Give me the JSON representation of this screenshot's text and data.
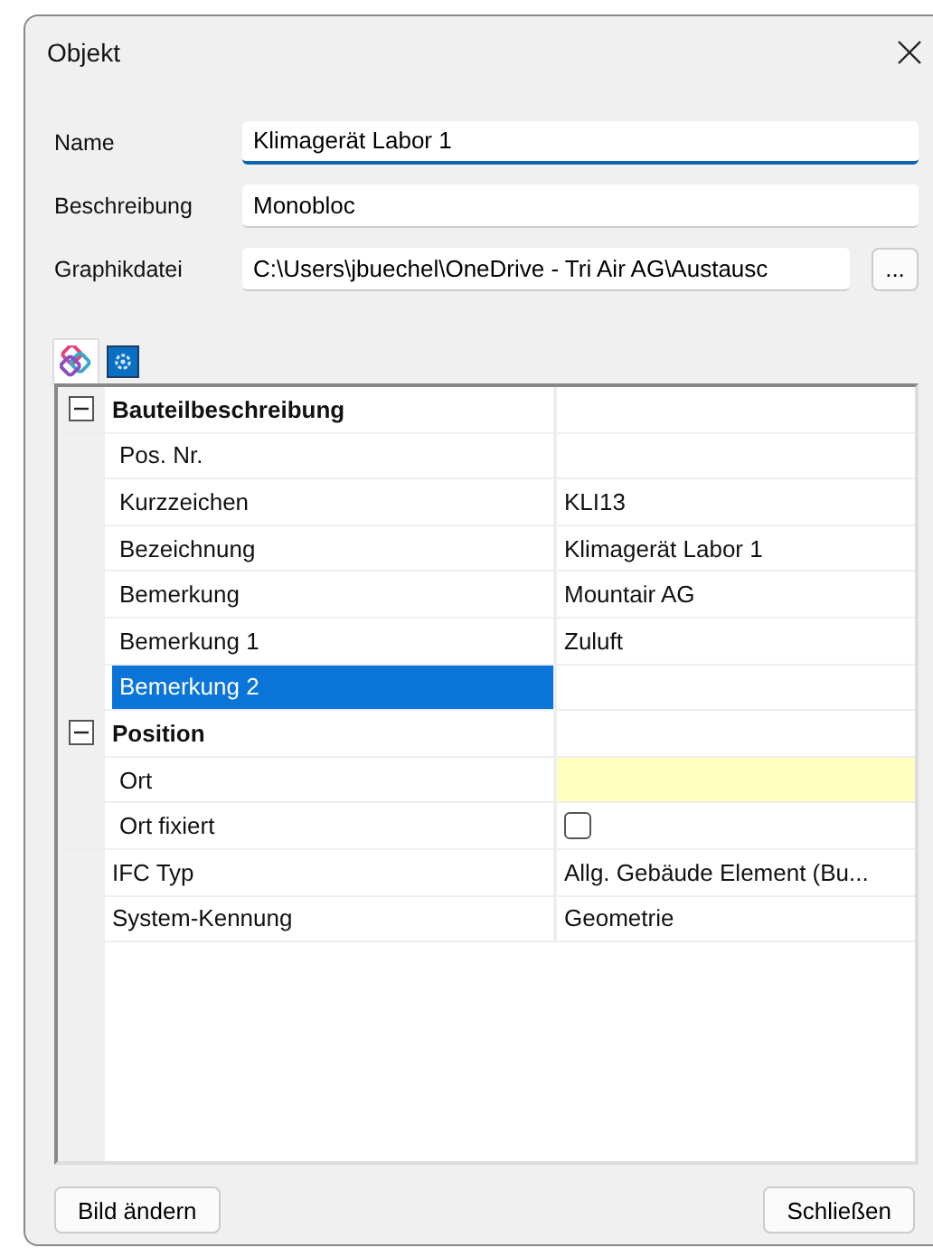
{
  "window": {
    "title": "Objekt"
  },
  "fields": [
    {
      "label": "Name",
      "value": "Klimagerät Labor 1",
      "focused": true
    },
    {
      "label": "Beschreibung",
      "value": "Monobloc",
      "focused": false
    },
    {
      "label": "Graphikdatei",
      "value": "C:\\Users\\jbuechel\\OneDrive - Tri Air AG\\Austausc",
      "focused": false,
      "browse": "..."
    }
  ],
  "tabs": [
    {
      "kind": "categories",
      "selected": true
    },
    {
      "kind": "settings",
      "selected": false
    }
  ],
  "property_grid": [
    {
      "kind": "category",
      "label": "Bauteilbeschreibung",
      "expanded": true,
      "children": [
        {
          "kind": "text",
          "label": "Pos. Nr.",
          "selected": false,
          "highlighted": false
        },
        {
          "kind": "text",
          "label": "Kurzzeichen",
          "value": "KLI13",
          "selected": false,
          "highlighted": false
        },
        {
          "kind": "text",
          "label": "Bezeichnung",
          "value": "Klimagerät Labor 1",
          "selected": false,
          "highlighted": false
        },
        {
          "kind": "text",
          "label": "Bemerkung",
          "value": "Mountair AG",
          "selected": false,
          "highlighted": false
        },
        {
          "kind": "text",
          "label": "Bemerkung 1",
          "value": "Zuluft",
          "selected": false,
          "highlighted": false
        },
        {
          "kind": "text",
          "label": "Bemerkung 2",
          "selected": true,
          "highlighted": false
        }
      ]
    },
    {
      "kind": "category",
      "label": "Position",
      "expanded": true,
      "children": [
        {
          "kind": "text",
          "label": "Ort",
          "selected": false,
          "highlighted": true
        },
        {
          "kind": "checkbox",
          "label": "Ort fixiert",
          "checked": false,
          "selected": false,
          "highlighted": false
        }
      ]
    },
    {
      "kind": "text",
      "label": "IFC Typ",
      "value": "Allg. Gebäude Element (Bu...",
      "selected": false,
      "highlighted": false
    },
    {
      "kind": "text",
      "label": "System-Kennung",
      "value": "Geometrie",
      "selected": false,
      "highlighted": false
    }
  ],
  "buttons": [
    {
      "label": "Bild ändern"
    },
    {
      "label": "Schließen"
    }
  ]
}
